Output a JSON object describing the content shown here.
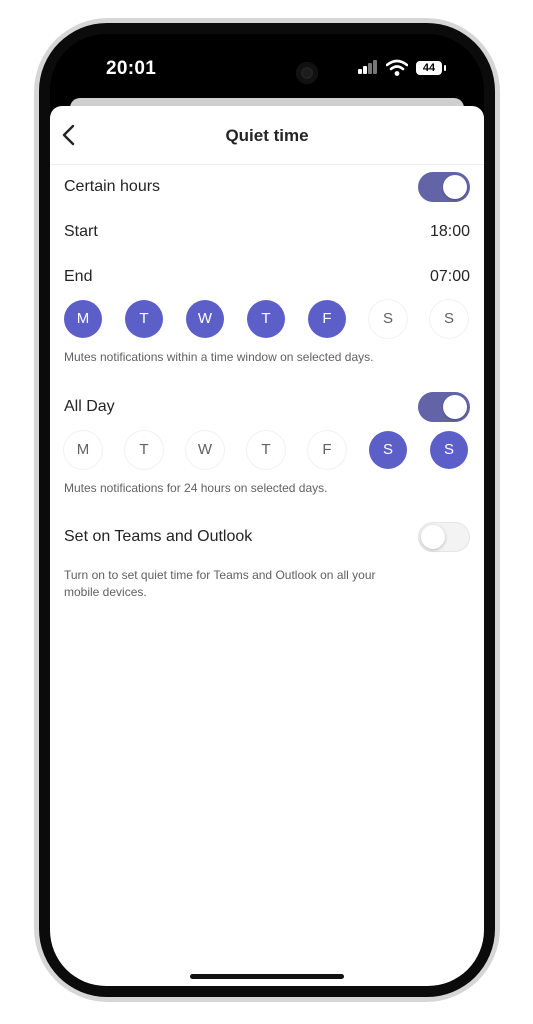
{
  "status_bar": {
    "time": "20:01",
    "battery": "44"
  },
  "header": {
    "title": "Quiet time"
  },
  "certain_hours": {
    "label": "Certain hours",
    "enabled": true,
    "start_label": "Start",
    "start_value": "18:00",
    "end_label": "End",
    "end_value": "07:00",
    "days": [
      {
        "letter": "M",
        "selected": true
      },
      {
        "letter": "T",
        "selected": true
      },
      {
        "letter": "W",
        "selected": true
      },
      {
        "letter": "T",
        "selected": true
      },
      {
        "letter": "F",
        "selected": true
      },
      {
        "letter": "S",
        "selected": false
      },
      {
        "letter": "S",
        "selected": false
      }
    ],
    "hint": "Mutes notifications within a time window on selected days."
  },
  "all_day": {
    "label": "All Day",
    "enabled": true,
    "days": [
      {
        "letter": "M",
        "selected": false
      },
      {
        "letter": "T",
        "selected": false
      },
      {
        "letter": "W",
        "selected": false
      },
      {
        "letter": "T",
        "selected": false
      },
      {
        "letter": "F",
        "selected": false
      },
      {
        "letter": "S",
        "selected": true
      },
      {
        "letter": "S",
        "selected": true
      }
    ],
    "hint": "Mutes notifications for 24 hours on selected days."
  },
  "teams_outlook": {
    "label": "Set on Teams and Outlook",
    "enabled": false,
    "hint": "Turn on to set quiet time for Teams and Outlook on all your mobile devices."
  },
  "colors": {
    "accent": "#5b5fc7",
    "toggle_on": "#6264a7"
  },
  "icons": {
    "back": "chevron-left-icon",
    "signal": "cellular-signal-icon",
    "wifi": "wifi-icon",
    "battery": "battery-icon"
  }
}
